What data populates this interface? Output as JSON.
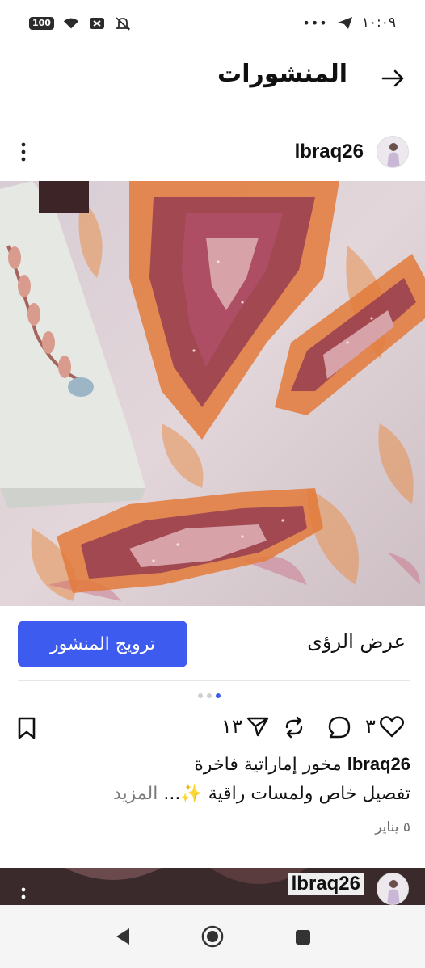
{
  "status_bar": {
    "battery": "100",
    "time": "١٠:٠٩",
    "dots": "•••"
  },
  "header": {
    "title": "المنشورات",
    "back_icon": "arrow-right-icon"
  },
  "post": {
    "username": "lbraq26",
    "photo_description": "embroidered-dress-fabric",
    "promote_label": "ترويج المنشور",
    "insights_label": "عرض الرؤى",
    "carousel": {
      "count": 3,
      "active_index": 2
    },
    "likes": "٣",
    "shares": "١٣",
    "caption_user": "lbraq26",
    "caption_line1": "مخور إماراتية فاخرة",
    "caption_line2": "تفصيل خاص ولمسات راقية ✨...",
    "more_label": "المزيد",
    "date": "٥ يناير",
    "accent_color": "#3e5bf0"
  },
  "next_post": {
    "username": "lbraq26"
  }
}
